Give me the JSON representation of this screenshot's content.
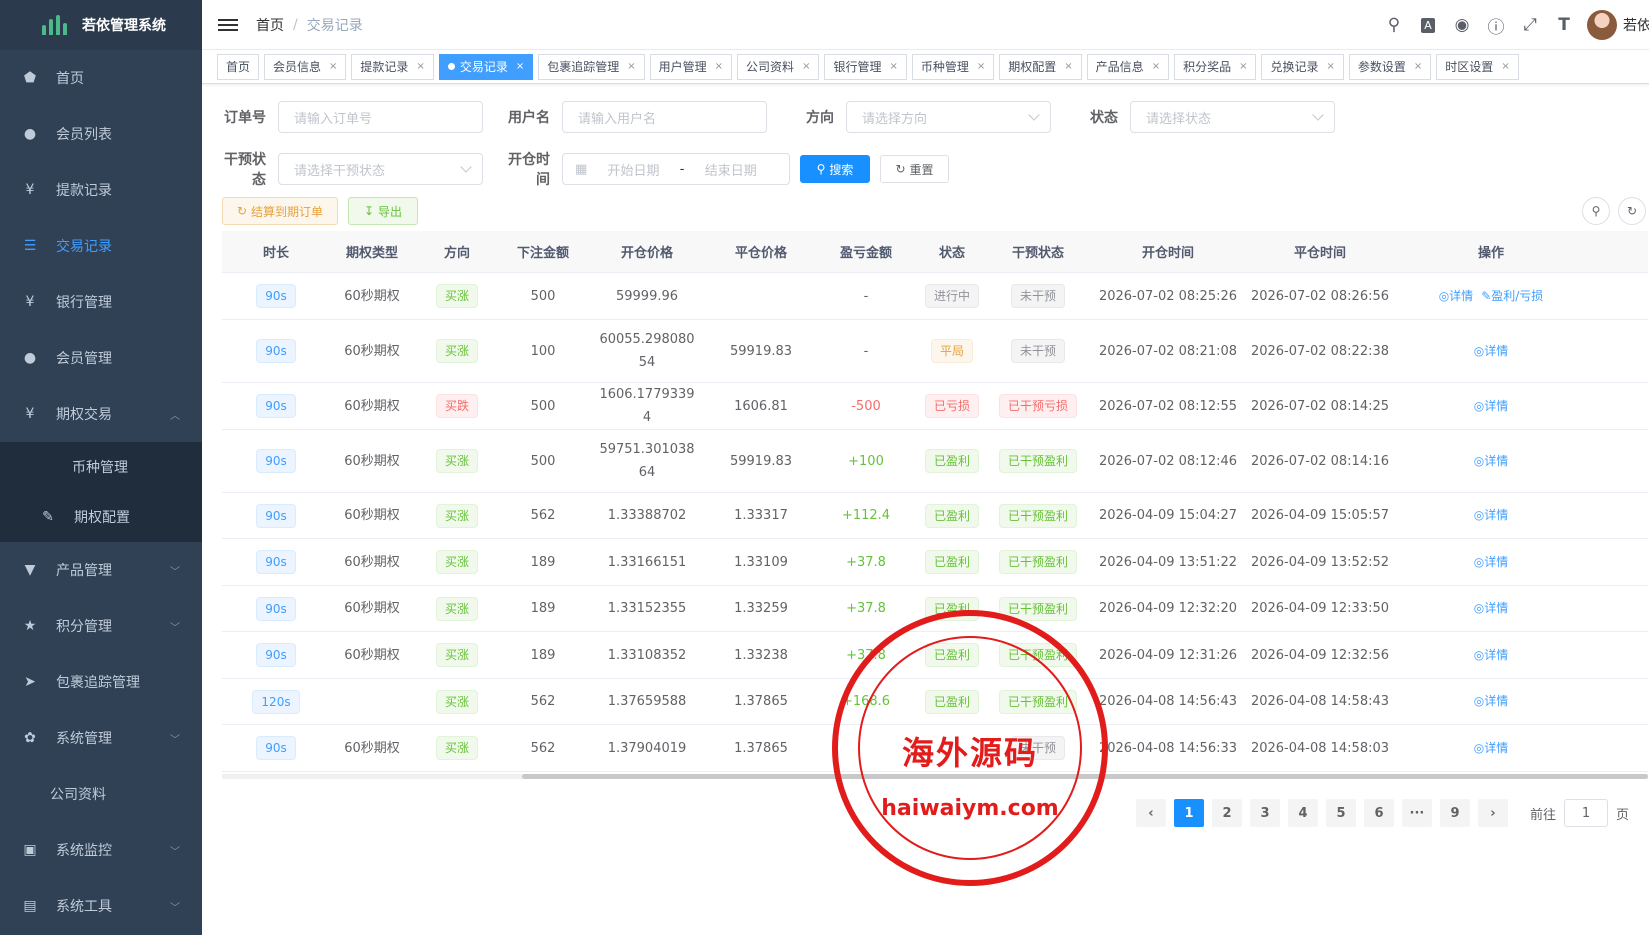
{
  "app": {
    "title": "若依管理系统",
    "user": "若依"
  },
  "sidebar": [
    {
      "label": "首页",
      "icon": "dashboard-icon",
      "glyph": "⬟"
    },
    {
      "label": "会员列表",
      "icon": "user-icon",
      "glyph": "●"
    },
    {
      "label": "提款记录",
      "icon": "yen-icon",
      "glyph": "¥"
    },
    {
      "label": "交易记录",
      "icon": "list-icon",
      "glyph": "☰"
    },
    {
      "label": "银行管理",
      "icon": "yen-icon",
      "glyph": "¥"
    },
    {
      "label": "会员管理",
      "icon": "peoples-icon",
      "glyph": "●"
    },
    {
      "label": "期权交易",
      "icon": "yen-icon",
      "glyph": "¥"
    },
    {
      "label": "币种管理"
    },
    {
      "label": "期权配置",
      "icon": "edit-icon",
      "glyph": "✎"
    },
    {
      "label": "产品管理",
      "icon": "cart-icon",
      "glyph": "▼"
    },
    {
      "label": "积分管理",
      "icon": "star-icon",
      "glyph": "★"
    },
    {
      "label": "包裹追踪管理",
      "icon": "send-icon",
      "glyph": "➤"
    },
    {
      "label": "系统管理",
      "icon": "gear-icon",
      "glyph": "✿"
    },
    {
      "label": "公司资料"
    },
    {
      "label": "系统监控",
      "icon": "monitor-icon",
      "glyph": "▣"
    },
    {
      "label": "系统工具",
      "icon": "tool-icon",
      "glyph": "▤"
    }
  ],
  "breadcrumb": {
    "home": "首页",
    "current": "交易记录"
  },
  "tags": [
    "首页",
    "会员信息",
    "提款记录",
    "交易记录",
    "包裹追踪管理",
    "用户管理",
    "公司资料",
    "银行管理",
    "币种管理",
    "期权配置",
    "产品信息",
    "积分奖品",
    "兑换记录",
    "参数设置",
    "时区设置"
  ],
  "filters": {
    "order_label": "订单号",
    "order_ph": "请输入订单号",
    "user_label": "用户名",
    "user_ph": "请输入用户名",
    "dir_label": "方向",
    "dir_ph": "请选择方向",
    "status_label": "状态",
    "status_ph": "请选择状态",
    "intervene_label": "干预状态",
    "intervene_ph": "请选择干预状态",
    "time_label": "开仓时间",
    "start_ph": "开始日期",
    "dash": "-",
    "end_ph": "结束日期",
    "search": "搜索",
    "reset": "重置"
  },
  "actions": {
    "settle": "结算到期订单",
    "export": "导出"
  },
  "columns": [
    "时长",
    "期权类型",
    "方向",
    "下注金额",
    "开仓价格",
    "平仓价格",
    "盈亏金额",
    "状态",
    "干预状态",
    "开仓时间",
    "平仓时间",
    "操作"
  ],
  "rows": [
    {
      "dur": "90s",
      "type": "60秒期权",
      "dir": "买涨",
      "amt": "500",
      "open": "59999.96",
      "close": "",
      "pnl": "-",
      "status": "进行中",
      "iv": "未干预",
      "ot": "2026-07-02 08:25:26",
      "ct": "2026-07-02 08:26:56",
      "op1": "◎详情",
      "op2": "✎盈利/亏损"
    },
    {
      "dur": "90s",
      "type": "60秒期权",
      "dir": "买涨",
      "amt": "100",
      "open": "60055.29808054",
      "close": "59919.83",
      "pnl": "-",
      "status": "平局",
      "iv": "未干预",
      "ot": "2026-07-02 08:21:08",
      "ct": "2026-07-02 08:22:38",
      "op1": "◎详情",
      "op2": ""
    },
    {
      "dur": "90s",
      "type": "60秒期权",
      "dir": "买跌",
      "amt": "500",
      "open": "1606.17793394",
      "close": "1606.81",
      "pnl": "-500",
      "status": "已亏损",
      "iv": "已干预亏损",
      "ot": "2026-07-02 08:12:55",
      "ct": "2026-07-02 08:14:25",
      "op1": "◎详情",
      "op2": ""
    },
    {
      "dur": "90s",
      "type": "60秒期权",
      "dir": "买涨",
      "amt": "500",
      "open": "59751.30103864",
      "close": "59919.83",
      "pnl": "+100",
      "status": "已盈利",
      "iv": "已干预盈利",
      "ot": "2026-07-02 08:12:46",
      "ct": "2026-07-02 08:14:16",
      "op1": "◎详情",
      "op2": ""
    },
    {
      "dur": "90s",
      "type": "60秒期权",
      "dir": "买涨",
      "amt": "562",
      "open": "1.33388702",
      "close": "1.33317",
      "pnl": "+112.4",
      "status": "已盈利",
      "iv": "已干预盈利",
      "ot": "2026-04-09 15:04:27",
      "ct": "2026-04-09 15:05:57",
      "op1": "◎详情",
      "op2": ""
    },
    {
      "dur": "90s",
      "type": "60秒期权",
      "dir": "买涨",
      "amt": "189",
      "open": "1.33166151",
      "close": "1.33109",
      "pnl": "+37.8",
      "status": "已盈利",
      "iv": "已干预盈利",
      "ot": "2026-04-09 13:51:22",
      "ct": "2026-04-09 13:52:52",
      "op1": "◎详情",
      "op2": ""
    },
    {
      "dur": "90s",
      "type": "60秒期权",
      "dir": "买涨",
      "amt": "189",
      "open": "1.33152355",
      "close": "1.33259",
      "pnl": "+37.8",
      "status": "已盈利",
      "iv": "已干预盈利",
      "ot": "2026-04-09 12:32:20",
      "ct": "2026-04-09 12:33:50",
      "op1": "◎详情",
      "op2": ""
    },
    {
      "dur": "90s",
      "type": "60秒期权",
      "dir": "买涨",
      "amt": "189",
      "open": "1.33108352",
      "close": "1.33238",
      "pnl": "+37.8",
      "status": "已盈利",
      "iv": "已干预盈利",
      "ot": "2026-04-09 12:31:26",
      "ct": "2026-04-09 12:32:56",
      "op1": "◎详情",
      "op2": ""
    },
    {
      "dur": "120s",
      "type": "",
      "dir": "买涨",
      "amt": "562",
      "open": "1.37659588",
      "close": "1.37865",
      "pnl": "+168.6",
      "status": "已盈利",
      "iv": "已干预盈利",
      "ot": "2026-04-08 14:56:43",
      "ct": "2026-04-08 14:58:43",
      "op1": "◎详情",
      "op2": ""
    },
    {
      "dur": "90s",
      "type": "60秒期权",
      "dir": "买涨",
      "amt": "562",
      "open": "1.37904019",
      "close": "1.37865",
      "pnl": "",
      "status": "",
      "iv": "未干预",
      "ot": "2026-04-08 14:56:33",
      "ct": "2026-04-08 14:58:03",
      "op1": "◎详情",
      "op2": ""
    }
  ],
  "pager": {
    "pages": [
      "1",
      "2",
      "3",
      "4",
      "5",
      "6",
      "···",
      "9"
    ],
    "goto": "前往",
    "goto_val": "1",
    "page_unit": "页"
  },
  "watermark": {
    "center": "海外源码",
    "url": "haiwaiym.com"
  }
}
